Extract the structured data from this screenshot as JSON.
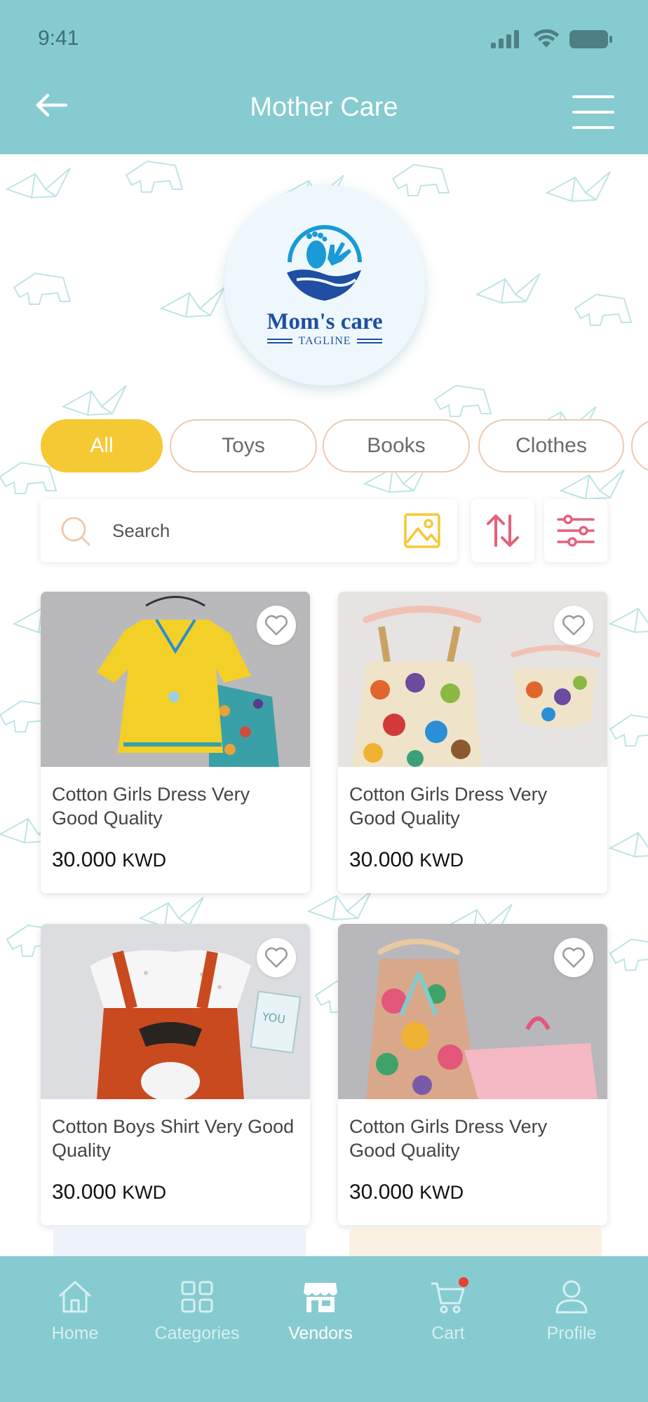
{
  "status_bar": {
    "time": "9:41"
  },
  "header": {
    "title": "Mother Care"
  },
  "logo": {
    "name": "Mom's care",
    "tagline": "TAGLINE"
  },
  "filters": [
    {
      "label": "All",
      "active": true
    },
    {
      "label": "Toys",
      "active": false
    },
    {
      "label": "Books",
      "active": false
    },
    {
      "label": "Clothes",
      "active": false
    }
  ],
  "search": {
    "placeholder": "Search"
  },
  "products": [
    {
      "title": "Cotton Girls Dress Very Good Quality",
      "price": "30.000",
      "currency": "KWD"
    },
    {
      "title": "Cotton Girls Dress Very Good Quality",
      "price": "30.000",
      "currency": "KWD"
    },
    {
      "title": "Cotton Boys Shirt Very Good Quality",
      "price": "30.000",
      "currency": "KWD"
    },
    {
      "title": "Cotton Girls Dress Very Good Quality",
      "price": "30.000",
      "currency": "KWD"
    }
  ],
  "bottom_nav": [
    {
      "label": "Home",
      "icon": "home-icon"
    },
    {
      "label": "Categories",
      "icon": "grid-icon"
    },
    {
      "label": "Vendors",
      "icon": "store-icon",
      "active": true
    },
    {
      "label": "Cart",
      "icon": "cart-icon",
      "badge": true
    },
    {
      "label": "Profile",
      "icon": "user-icon"
    }
  ],
  "colors": {
    "header": "#86cbd0",
    "accent": "#f5c933",
    "chip_border": "#efc8b0",
    "sort_icon": "#e5607a",
    "badge": "#e8412d"
  }
}
